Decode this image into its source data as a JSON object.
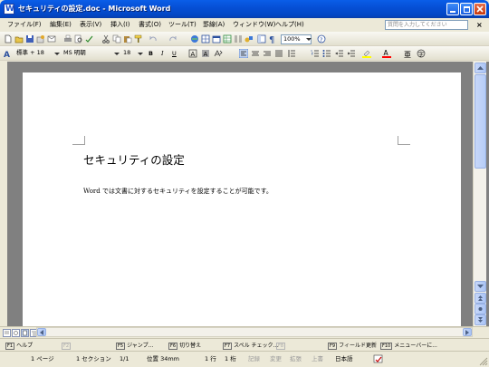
{
  "window": {
    "title": "セキュリティの設定.doc - Microsoft Word",
    "app_icon_letter": "W"
  },
  "menubar": {
    "items": [
      "ファイル(F)",
      "編集(E)",
      "表示(V)",
      "挿入(I)",
      "書式(O)",
      "ツール(T)",
      "罫線(A)",
      "ウィンドウ(W)",
      "ヘルプ(H)"
    ],
    "help_placeholder": "質問を入力してください",
    "close_glyph": "×"
  },
  "toolbar1": {
    "zoom": "100%",
    "help_glyph": "?"
  },
  "toolbar2": {
    "style": "標準 + 18",
    "font": "MS 明朝",
    "size": "18",
    "bold": "B",
    "italic": "I",
    "underline": "U"
  },
  "document": {
    "heading": "セキュリティの設定",
    "body": "Word では文書に対するセキュリティを設定することが可能です。"
  },
  "function_keys": [
    {
      "num": "F1",
      "label": "ヘルプ",
      "enabled": true
    },
    {
      "num": "F2",
      "label": "",
      "enabled": false
    },
    {
      "num": "F5",
      "label": "ジャンプ...",
      "enabled": true
    },
    {
      "num": "F6",
      "label": "切り替え",
      "enabled": true
    },
    {
      "num": "F7",
      "label": "スペル チェック...",
      "enabled": true
    },
    {
      "num": "F8",
      "label": "",
      "enabled": false
    },
    {
      "num": "F9",
      "label": "フィールド更新",
      "enabled": true
    },
    {
      "num": "F10",
      "label": "メニューバーに...",
      "enabled": true
    }
  ],
  "statusbar": {
    "page": "1 ページ",
    "section": "1 セクション",
    "page_of": "1/1",
    "position": "位置 34mm",
    "line": "1 行",
    "column": "1 桁",
    "rec": "記録",
    "trk": "変更",
    "ext": "拡張",
    "ovr": "上書",
    "language": "日本語"
  },
  "colors": {
    "titlebar": "#0650d6",
    "doc_background": "#808080",
    "chrome": "#ece9d8"
  }
}
